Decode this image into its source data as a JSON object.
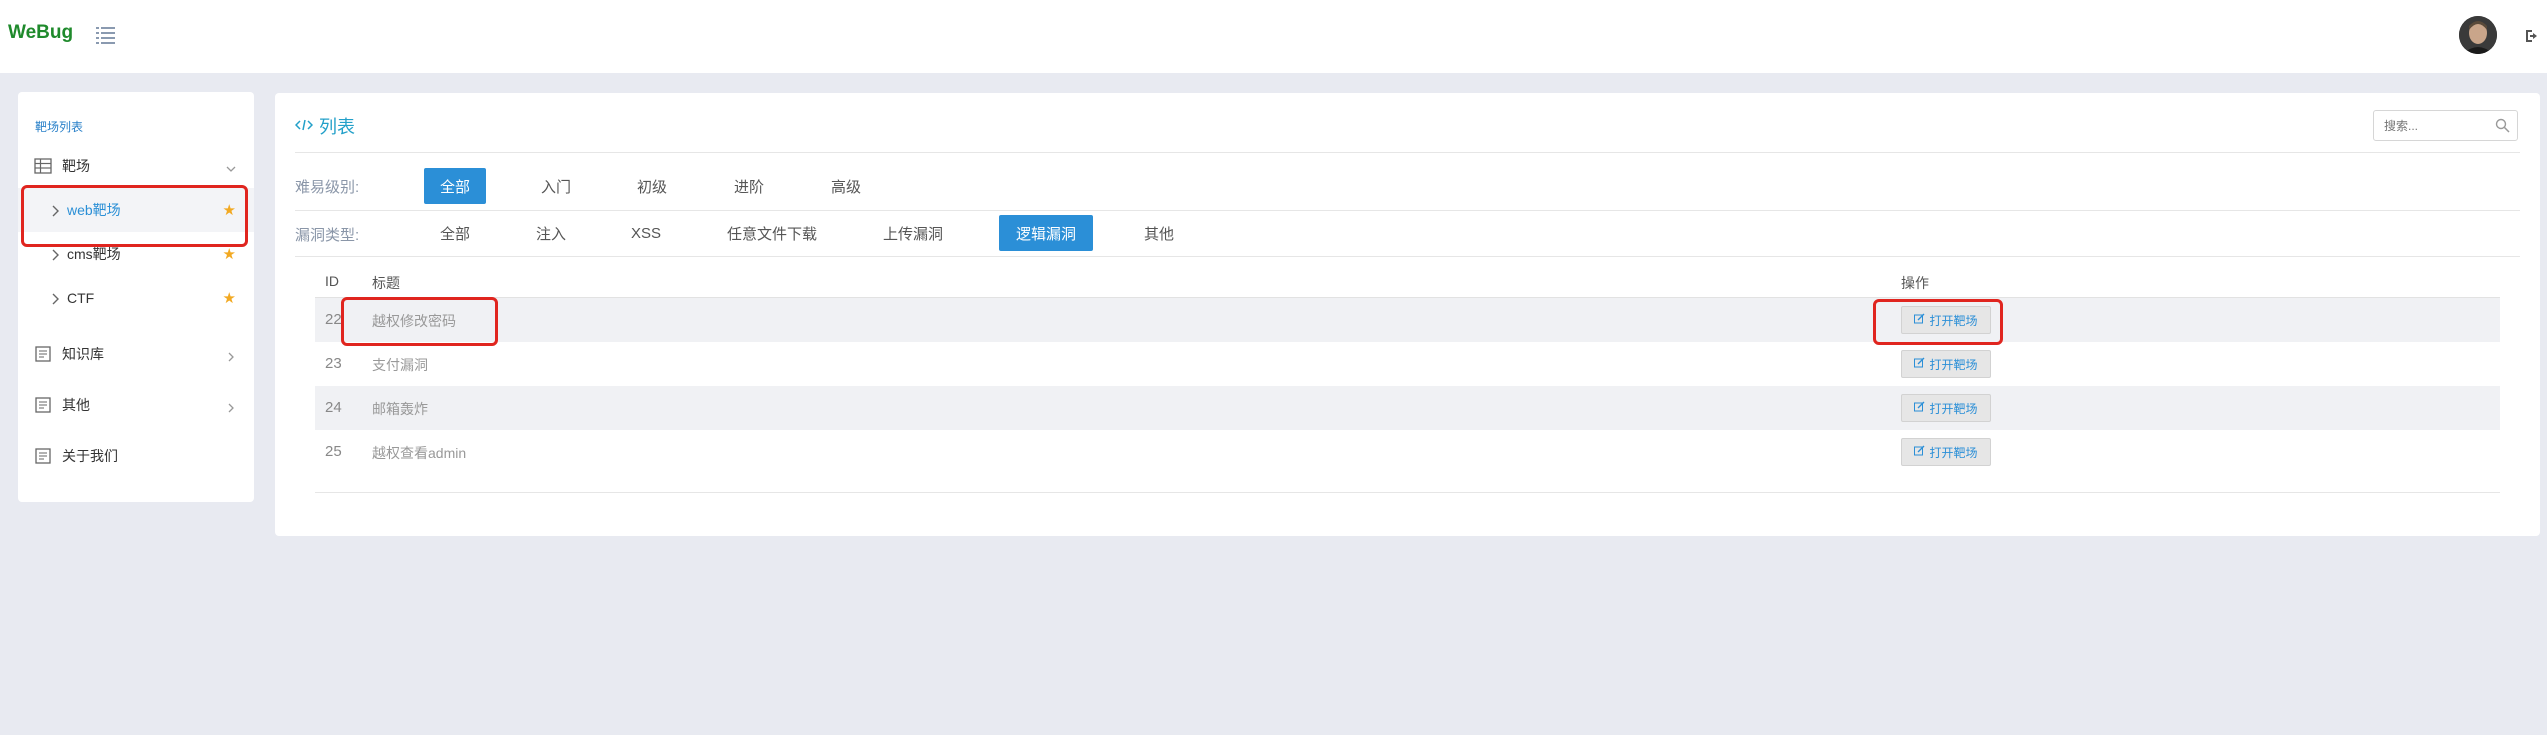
{
  "app": {
    "brand": "WeBug"
  },
  "sidebar": {
    "heading": "靶场列表",
    "group": {
      "label": "靶场"
    },
    "sub_items": [
      {
        "label": "web靶场",
        "active": true
      },
      {
        "label": "cms靶场",
        "active": false
      },
      {
        "label": "CTF",
        "active": false
      }
    ],
    "items": [
      {
        "label": "知识库"
      },
      {
        "label": "其他"
      },
      {
        "label": "关于我们"
      }
    ]
  },
  "main": {
    "title": "列表",
    "search_placeholder": "搜索...",
    "difficulty": {
      "label": "难易级别:",
      "options": [
        "全部",
        "入门",
        "初级",
        "进阶",
        "高级"
      ],
      "selected": "全部"
    },
    "vuln_type": {
      "label": "漏洞类型:",
      "options": [
        "全部",
        "注入",
        "XSS",
        "任意文件下载",
        "上传漏洞",
        "逻辑漏洞",
        "其他"
      ],
      "selected": "逻辑漏洞"
    },
    "table": {
      "headers": {
        "id": "ID",
        "title": "标题",
        "action": "操作"
      },
      "rows": [
        {
          "id": "22",
          "title": "越权修改密码",
          "action": "打开靶场"
        },
        {
          "id": "23",
          "title": "支付漏洞",
          "action": "打开靶场"
        },
        {
          "id": "24",
          "title": "邮箱轰炸",
          "action": "打开靶场"
        },
        {
          "id": "25",
          "title": "越权查看admin",
          "action": "打开靶场"
        }
      ]
    }
  },
  "colors": {
    "brand": "#1f8a2c",
    "accent": "#2b8fd7",
    "star": "#f2a922",
    "highlight": "#e0251f"
  }
}
